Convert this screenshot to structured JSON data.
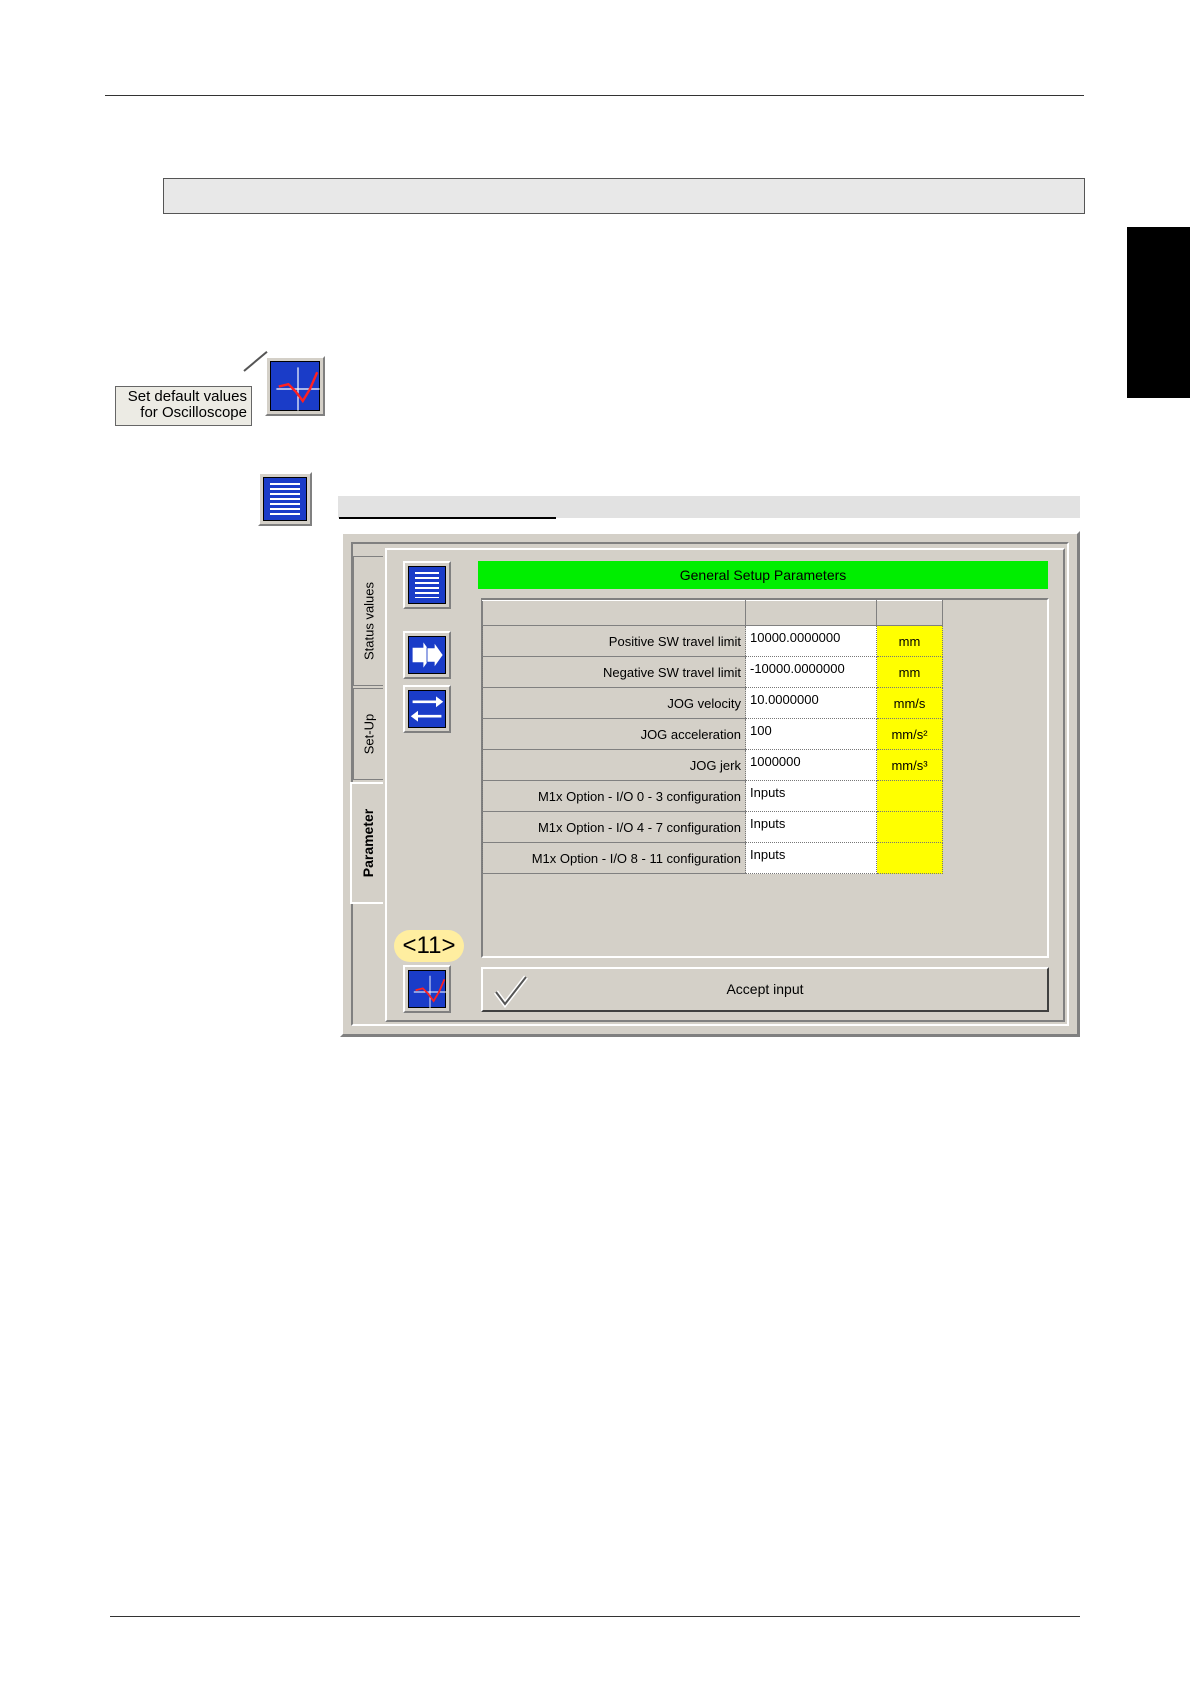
{
  "callout": {
    "line1": "Set default values",
    "line2": "for Oscilloscope"
  },
  "tabs": [
    {
      "label": "Status values"
    },
    {
      "label": "Set-Up"
    },
    {
      "label": "Parameter"
    }
  ],
  "panel": {
    "title": "General Setup Parameters"
  },
  "parameters": [
    {
      "name": "Positive SW travel limit",
      "value": "10000.0000000",
      "unit": "mm"
    },
    {
      "name": "Negative SW travel limit",
      "value": "-10000.0000000",
      "unit": "mm"
    },
    {
      "name": "JOG velocity",
      "value": "10.0000000",
      "unit": "mm/s"
    },
    {
      "name": "JOG acceleration",
      "value": "100",
      "unit": "mm/s²"
    },
    {
      "name": "JOG jerk",
      "value": "1000000",
      "unit": "mm/s³"
    },
    {
      "name": "M1x Option - I/O 0 - 3 configuration",
      "value": "Inputs",
      "unit": ""
    },
    {
      "name": "M1x Option - I/O 4 - 7 configuration",
      "value": "Inputs",
      "unit": ""
    },
    {
      "name": "M1x Option - I/O 8 - 11 configuration",
      "value": "Inputs",
      "unit": ""
    }
  ],
  "counter": "<11>",
  "accept": {
    "label": "Accept input"
  },
  "icons": {
    "list": "list-icon",
    "transfer": "transfer-icon",
    "swap": "swap-icon",
    "oscilloscope": "oscilloscope-icon",
    "check": "checkmark-icon"
  },
  "colors": {
    "header": "#00ee00",
    "unit_cells": "#ffff00",
    "icon_blue": "#1a3cc8"
  }
}
